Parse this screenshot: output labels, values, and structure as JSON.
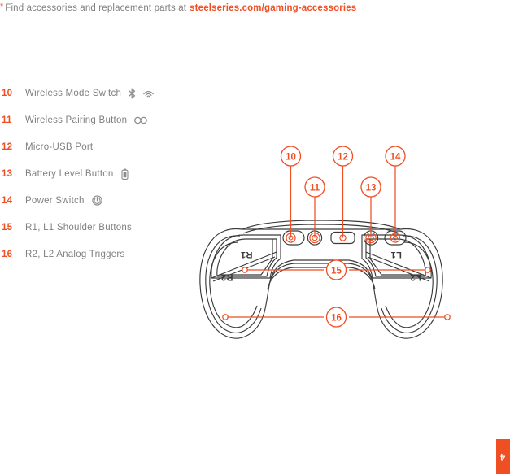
{
  "footnote": {
    "asterisk": "*",
    "text": "Find accessories and replacement parts at",
    "link_text": "steelseries.com/gaming-accessories"
  },
  "legend": {
    "items": [
      {
        "number": "10",
        "label": "Wireless Mode Switch",
        "icons": [
          "bluetooth-icon",
          "wireless-icon"
        ]
      },
      {
        "number": "11",
        "label": "Wireless Pairing Button",
        "icons": [
          "link-icon"
        ]
      },
      {
        "number": "12",
        "label": "Micro-USB Port",
        "icons": []
      },
      {
        "number": "13",
        "label": "Battery Level Button",
        "icons": [
          "battery-icon"
        ]
      },
      {
        "number": "14",
        "label": "Power Switch",
        "icons": [
          "power-icon"
        ]
      },
      {
        "number": "15",
        "label": "R1, L1 Shoulder Buttons",
        "icons": []
      },
      {
        "number": "16",
        "label": "R2, L2 Analog Triggers",
        "icons": []
      }
    ]
  },
  "diagram": {
    "view_label": "controller-rear-view",
    "callouts": [
      {
        "number": "10",
        "target": "wireless-mode-switch"
      },
      {
        "number": "11",
        "target": "wireless-pairing-button"
      },
      {
        "number": "12",
        "target": "micro-usb-port"
      },
      {
        "number": "13",
        "target": "battery-level-button"
      },
      {
        "number": "14",
        "target": "power-switch"
      },
      {
        "number": "15",
        "target": "shoulder-buttons"
      },
      {
        "number": "16",
        "target": "analog-triggers"
      }
    ],
    "body_labels": {
      "right_shoulder": "R1",
      "right_trigger": "R2",
      "left_shoulder": "L1",
      "left_trigger": "L2"
    }
  },
  "page": {
    "number": "4"
  },
  "colors": {
    "accent": "#f04e23",
    "text": "#808080",
    "outline": "#3a3a3a"
  }
}
